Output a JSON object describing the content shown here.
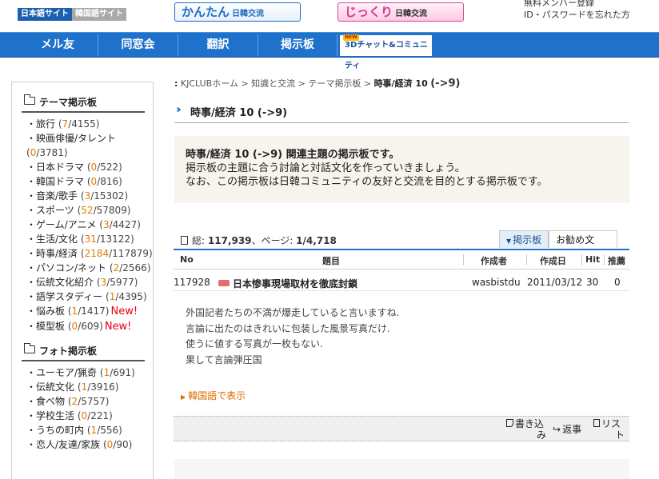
{
  "header": {
    "lang_jp": "日本語サイト",
    "lang_kr": "韓国語サイト",
    "logo_kantan_main": "かんたん",
    "logo_kantan_sub": "日韓交流",
    "logo_jikkuri_main": "じっくり",
    "logo_jikkuri_sub": "日韓交流",
    "link_register": "無料メンバー登録",
    "link_forgot": "ID・パスワードを忘れた方"
  },
  "nav": {
    "items": [
      "メル友",
      "同窓会",
      "翻訳",
      "掲示板"
    ],
    "chat_badge": "NEW",
    "chat_label": "3Dチャット&コミュニティ"
  },
  "sidebar": {
    "theme_title": "テーマ掲示板",
    "theme_items": [
      {
        "name": "旅行",
        "new": "7",
        "total": "4155",
        "flag": ""
      },
      {
        "name": "映画俳優/タレント",
        "new": "0",
        "total": "3781",
        "flag": ""
      },
      {
        "name": "日本ドラマ",
        "new": "0",
        "total": "522",
        "flag": ""
      },
      {
        "name": "韓国ドラマ",
        "new": "0",
        "total": "816",
        "flag": ""
      },
      {
        "name": "音楽/歌手",
        "new": "3",
        "total": "15302",
        "flag": ""
      },
      {
        "name": "スポーツ",
        "new": "52",
        "total": "57809",
        "flag": ""
      },
      {
        "name": "ゲーム/アニメ",
        "new": "3",
        "total": "4427",
        "flag": ""
      },
      {
        "name": "生活/文化",
        "new": "31",
        "total": "13122",
        "flag": ""
      },
      {
        "name": "時事/経済",
        "new": "2184",
        "total": "117879",
        "flag": ""
      },
      {
        "name": "パソコン/ネット",
        "new": "2",
        "total": "2566",
        "flag": ""
      },
      {
        "name": "伝統文化紹介",
        "new": "3",
        "total": "5977",
        "flag": ""
      },
      {
        "name": "語学スタディー",
        "new": "1",
        "total": "4395",
        "flag": ""
      },
      {
        "name": "悩み板",
        "new": "1",
        "total": "1417",
        "flag": "New!"
      },
      {
        "name": "模型板",
        "new": "0",
        "total": "609",
        "flag": "New!"
      }
    ],
    "photo_title": "フォト掲示板",
    "photo_items": [
      {
        "name": "ユーモア/猟奇",
        "new": "1",
        "total": "691"
      },
      {
        "name": "伝統文化",
        "new": "1",
        "total": "3916"
      },
      {
        "name": "食べ物",
        "new": "2",
        "total": "5757"
      },
      {
        "name": "学校生活",
        "new": "0",
        "total": "221"
      },
      {
        "name": "うちの町内",
        "new": "1",
        "total": "556"
      },
      {
        "name": "恋人/友達/家族",
        "new": "0",
        "total": "90"
      }
    ]
  },
  "breadcrumb": {
    "home": "KJCLUBホーム",
    "sep": ">",
    "level1": "知識と交流",
    "level2": "テーマ掲示板",
    "current": "時事/経済 10",
    "current_suffix": "(->9)"
  },
  "page": {
    "title": "時事/経済 10 (->9)",
    "intro_bold": "時事/経済 10 (->9) 関連主題の掲示板です。",
    "intro_line2": "掲示板の主題に合う討論と対話文化を作っていきましょう。",
    "intro_line3": "なお、この掲示板は日韓コミュニティの友好と交流を目的とする掲示板です。"
  },
  "stats": {
    "total_label": "総:",
    "total_value": "117,939",
    "page_label": "、ページ:",
    "page_value": "1/4,718"
  },
  "tabs": {
    "board": "掲示板",
    "recommend": "お勧め文"
  },
  "table": {
    "headers": [
      "No",
      "題目",
      "作成者",
      "作成日",
      "Hit",
      "推薦"
    ],
    "rows": [
      {
        "no": "117928",
        "title": "日本惨事現場取材を徹底封鎖",
        "author": "wasbistdu",
        "date": "2011/03/12",
        "hit": "30",
        "rec": "0"
      }
    ]
  },
  "post": {
    "lines": [
      "外国記者たちの不満が爆走していると言いますね.",
      "言論に出たのはきれいに包装した風景写真だけ.",
      "使うに値する写真が一枚もない.",
      "果して言論弾圧国"
    ],
    "korean_link": "韓国語で表示"
  },
  "actions": {
    "write_1": "書き込",
    "write_2": "み",
    "reply": "返事",
    "list_1": "リス",
    "list_2": "ト"
  }
}
